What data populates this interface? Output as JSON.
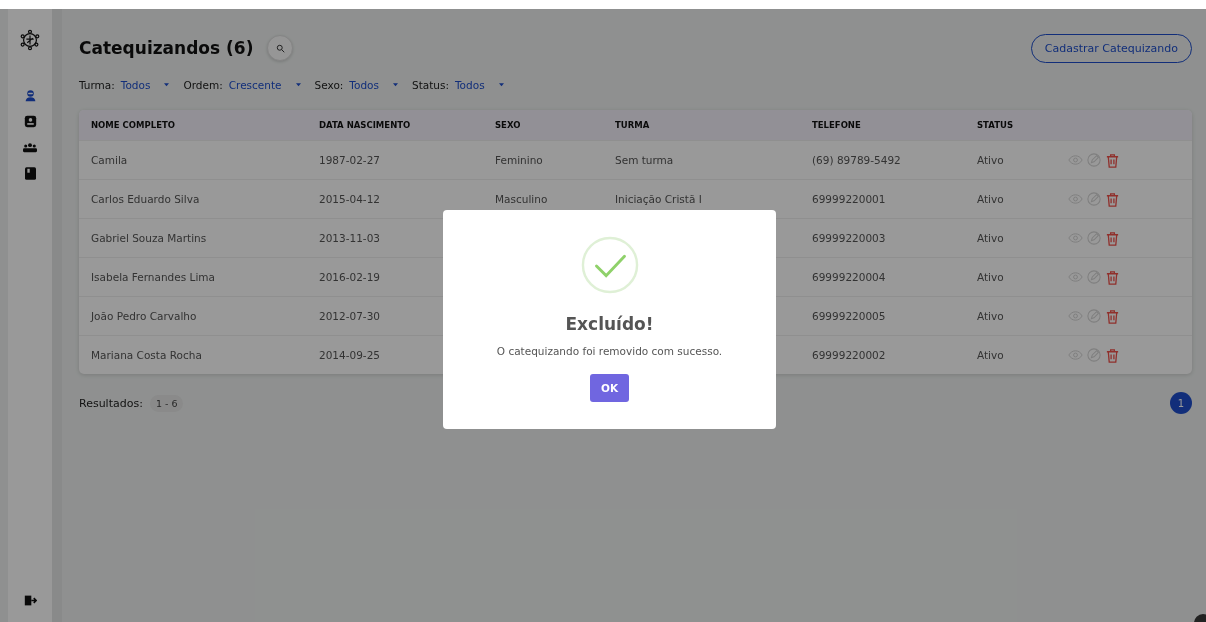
{
  "sidebar": {
    "items": [
      {
        "kind": "person",
        "selected": true
      },
      {
        "kind": "card",
        "selected": false
      },
      {
        "kind": "group",
        "selected": false
      },
      {
        "kind": "book",
        "selected": false
      }
    ]
  },
  "header": {
    "title": "Catequizandos (6)",
    "add_button": "Cadastrar Catequizando"
  },
  "filters": [
    {
      "label": "Turma:",
      "value": "Todos"
    },
    {
      "label": "Ordem:",
      "value": "Crescente"
    },
    {
      "label": "Sexo:",
      "value": "Todos"
    },
    {
      "label": "Status:",
      "value": "Todos"
    }
  ],
  "table": {
    "columns": [
      "NOME COMPLETO",
      "DATA NASCIMENTO",
      "SEXO",
      "TURMA",
      "TELEFONE",
      "STATUS"
    ],
    "rows": [
      {
        "nome": "Camila",
        "nascimento": "1987-02-27",
        "sexo": "Feminino",
        "turma": "Sem turma",
        "telefone": "(69) 89789-5492",
        "status": "Ativo"
      },
      {
        "nome": "Carlos Eduardo Silva",
        "nascimento": "2015-04-12",
        "sexo": "Masculino",
        "turma": "Iniciação Cristã I",
        "telefone": "69999220001",
        "status": "Ativo"
      },
      {
        "nome": "Gabriel Souza Martins",
        "nascimento": "2013-11-03",
        "telefone": "69999220003",
        "status": "Ativo"
      },
      {
        "nome": "Isabela Fernandes Lima",
        "nascimento": "2016-02-19",
        "telefone": "69999220004",
        "status": "Ativo"
      },
      {
        "nome": "João Pedro Carvalho",
        "nascimento": "2012-07-30",
        "telefone": "69999220005",
        "status": "Ativo"
      },
      {
        "nome": "Mariana Costa Rocha",
        "nascimento": "2014-09-25",
        "telefone": "69999220002",
        "status": "Ativo"
      }
    ]
  },
  "results": {
    "label": "Resultados:",
    "range": "1 - 6"
  },
  "pagination": [
    {
      "label": "1",
      "selected": true
    }
  ],
  "modal": {
    "title": "Excluído!",
    "message": "O catequizando foi removido com sucesso.",
    "button": "OK"
  }
}
